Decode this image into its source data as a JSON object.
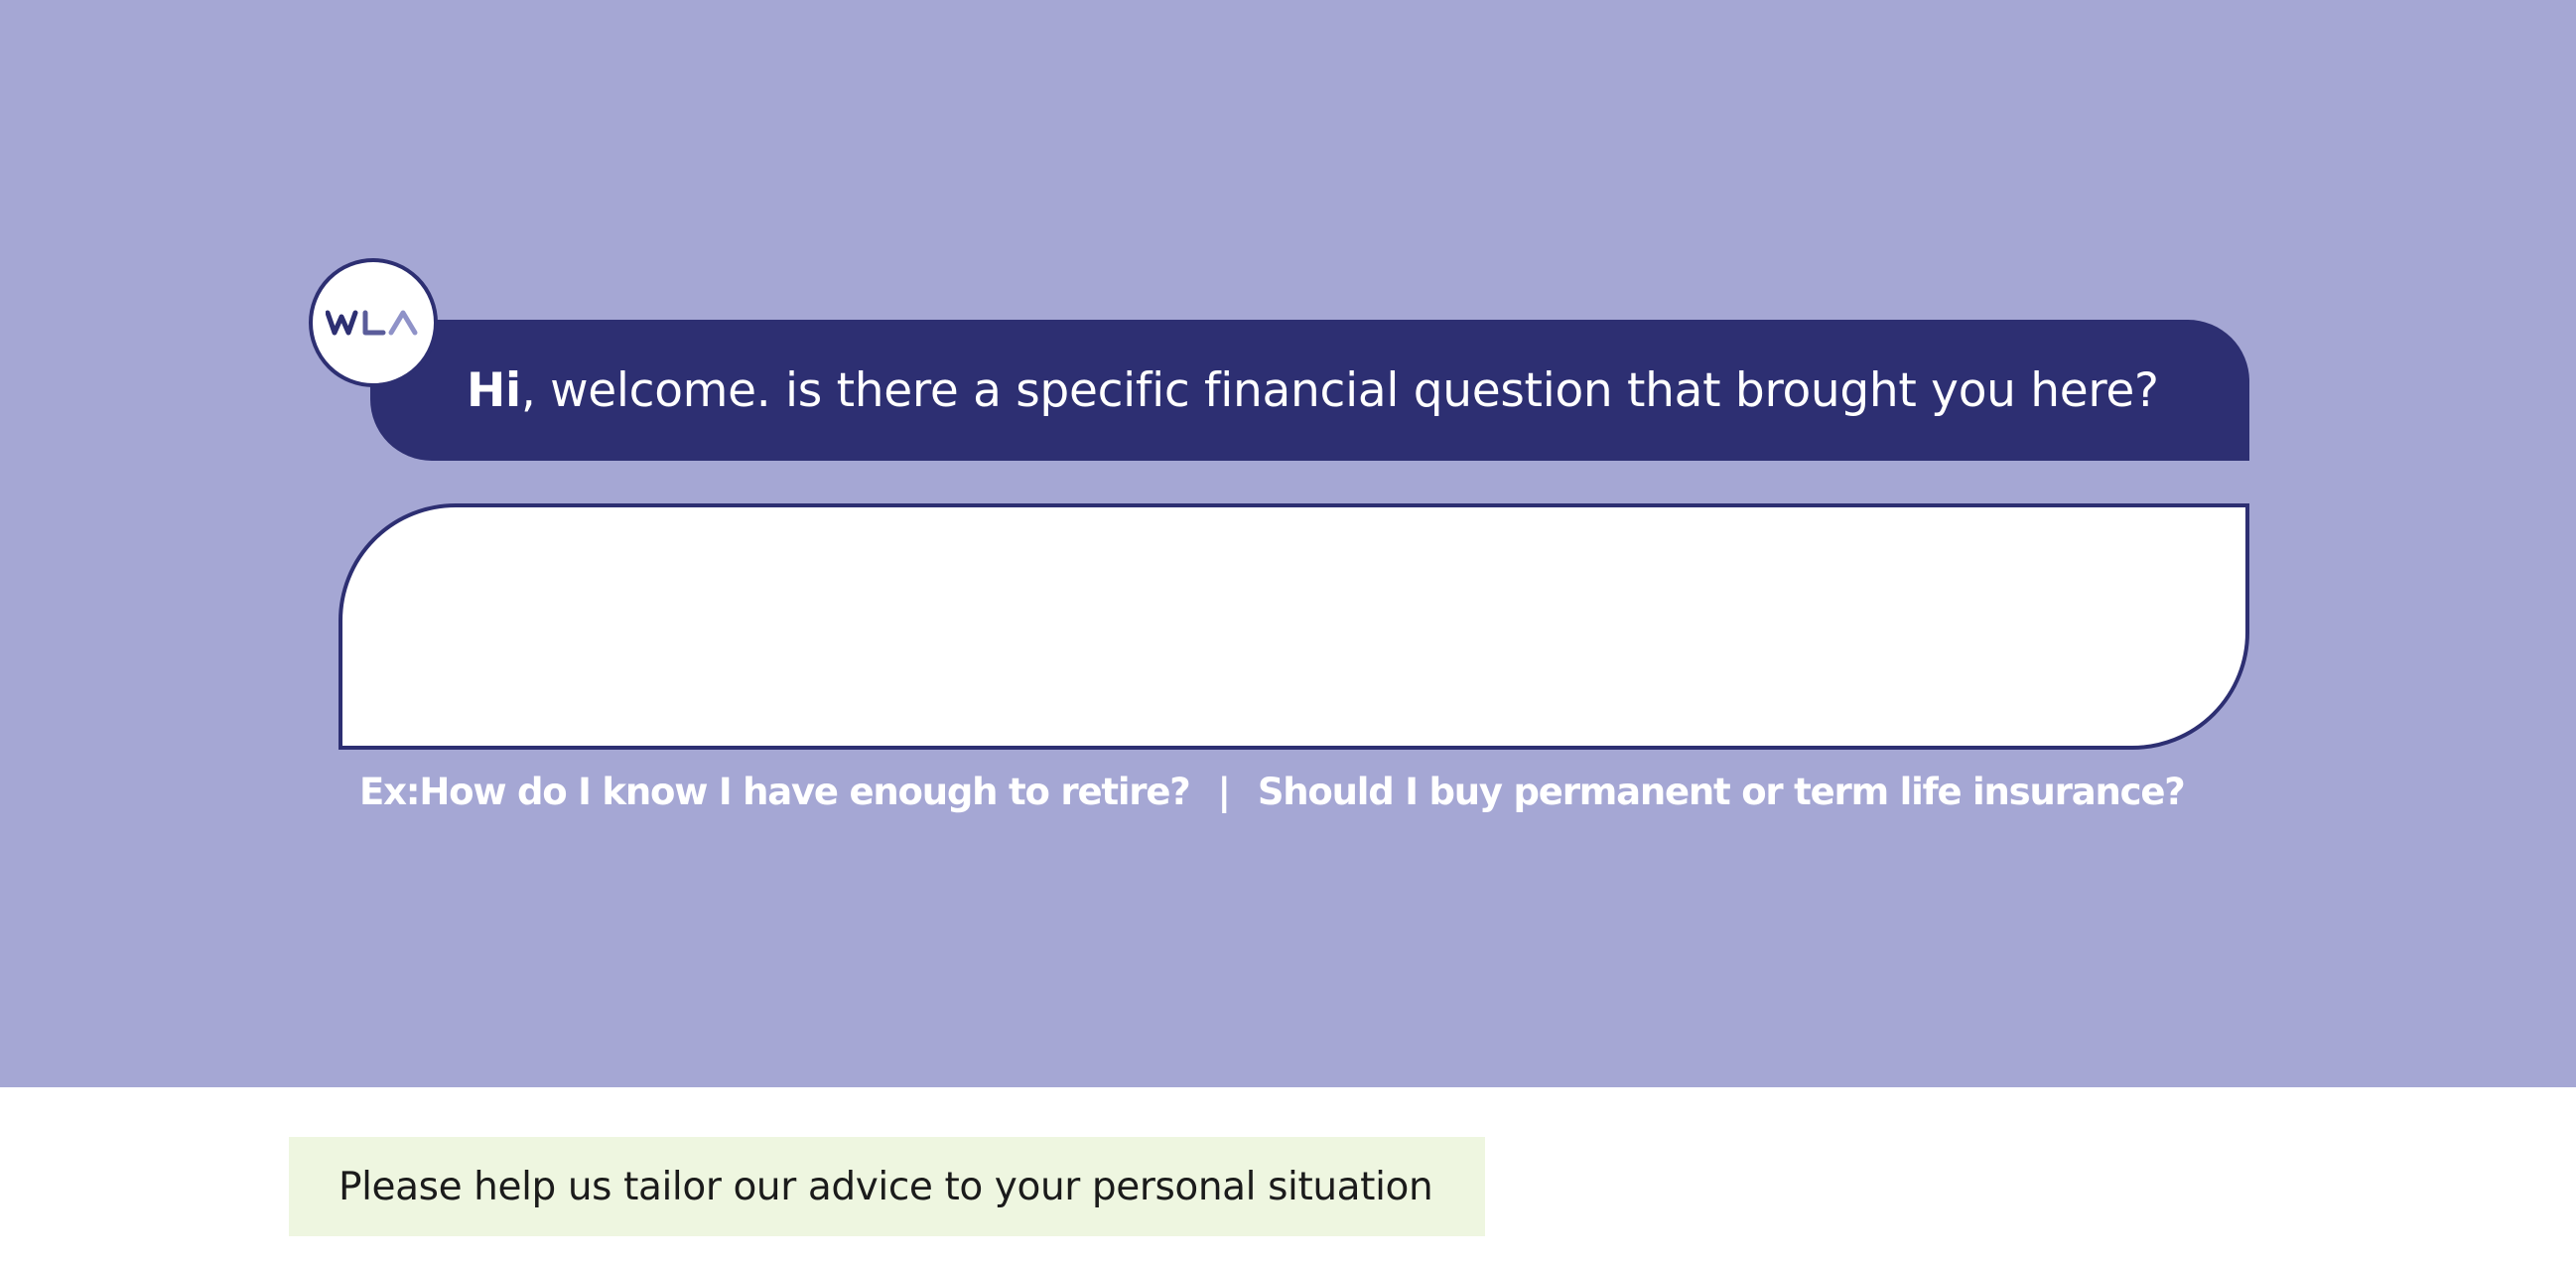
{
  "hero": {
    "background_color": "#a5a7d4",
    "avatar": {
      "logo_text": "WLA",
      "border_color": "#2d2f72"
    },
    "greeting": {
      "strong": "Hi",
      "rest": ", welcome. is there a specific financial question that brought you here?",
      "bubble_color": "#2d2f72"
    },
    "answer_input": {
      "value": "",
      "placeholder": ""
    },
    "examples": {
      "prefix": "Ex: ",
      "item_1": "How do I know I have enough to retire?",
      "separator": "|",
      "item_2": "Should I buy permanent or term life insurance?"
    }
  },
  "tailor_banner": {
    "text": "Please help us tailor our advice to your personal situation",
    "background_color": "#eef6e0"
  }
}
